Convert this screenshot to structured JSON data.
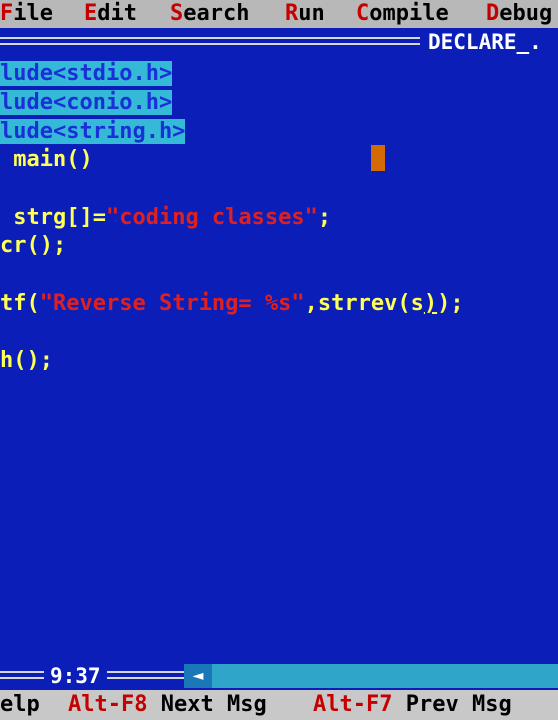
{
  "menu": [
    {
      "hot": "F",
      "rest": "ile"
    },
    {
      "hot": "E",
      "rest": "dit"
    },
    {
      "hot": "S",
      "rest": "earch"
    },
    {
      "hot": "R",
      "rest": "un"
    },
    {
      "hot": "C",
      "rest": "ompile"
    },
    {
      "hot": "D",
      "rest": "ebug"
    }
  ],
  "window": {
    "title": "DECLARE_."
  },
  "code": {
    "line1": "lude<stdio.h>",
    "line2": "lude<conio.h>",
    "line3": "lude<string.h>",
    "line4": " main()",
    "line5a": " strg[]=",
    "line5b": "\"coding classes\"",
    "line5c": ";",
    "line6": "cr();",
    "line7a": "tf(",
    "line7b": "\"Reverse String= %s\"",
    "line7c": ",strrev(s",
    "line7d": ")",
    "line7e": ");",
    "line8": "h();"
  },
  "status": {
    "position": "9:37"
  },
  "bottom": {
    "help_rest": "elp",
    "k1": "Alt-F8",
    "k1_label": "Next Msg",
    "k2": "Alt-F7",
    "k2_label": "Prev Msg"
  }
}
